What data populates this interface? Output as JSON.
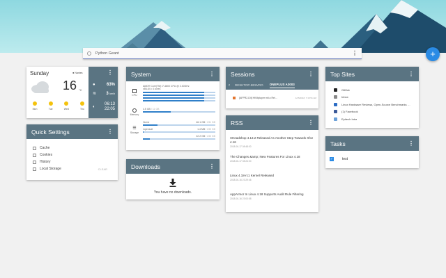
{
  "search": {
    "value": "Python Geant"
  },
  "fab": {
    "label": "+"
  },
  "weather": {
    "day": "Sunday",
    "location": "Nantes",
    "temp": "16",
    "unit": "°C",
    "humidity": "63%",
    "wind": "3",
    "wind_unit": "km/h",
    "sunrise": "06:13",
    "sunset": "22:05",
    "forecast": [
      {
        "day": "Mon"
      },
      {
        "day": "Tue"
      },
      {
        "day": "Wed"
      },
      {
        "day": "Thu"
      }
    ]
  },
  "system": {
    "title": "System",
    "cpu_label": "CPU",
    "cpu_info_1": "AMD® Core(TM) i7-4800 CPU @ 2.30GHz",
    "cpu_info_2": "x86-64 • 4 cores",
    "cpu_bars": [
      0.85,
      0.85,
      0.85,
      0.85
    ],
    "memory_label": "Memory",
    "memory_text": "4.5 GB",
    "memory_total": "/ 11 GB",
    "memory_fill": 0.38,
    "storage_label": "Storage",
    "storage": [
      {
        "name": "Home",
        "used": "46.1 GB",
        "total": "/ 231 GB",
        "fill": 0.2
      },
      {
        "name": "/opensuit",
        "used": "1.4 MB",
        "total": "/ 233 GB",
        "fill": 0.01
      },
      {
        "name": "",
        "used": "22.2 GB",
        "total": "/ 233 GB",
        "fill": 0.1
      }
    ]
  },
  "sessions": {
    "title": "Sessions",
    "tabs": [
      "DESKTOP-8E9VRO",
      "ONEPLUS A3003"
    ],
    "active_tab": 1,
    "item_text": "[AFPR2-Dit] HKMplayer mit a Rel…",
    "item_date": "4/15/2018, 7:15:51 AM"
  },
  "rss": {
    "title": "RSS",
    "items": [
      {
        "title": "XHeadshop 4.13.2 Released As Another Step Towards Xfce 4.16",
        "date": "2018-06-17 08:48:00"
      },
      {
        "title": "The Changes &amp; New Features For Linux 4.18",
        "date": "2018-06-17 08:24:00"
      },
      {
        "title": "Linux 4.18-rc1 Kernel Released",
        "date": "2018-06-16 23:29:46"
      },
      {
        "title": "AppArmor In Linux 4.18 Supports Audit Rule Filtering",
        "date": "2018-06-16 23:00:58"
      }
    ]
  },
  "quick_settings": {
    "title": "Quick Settings",
    "items": [
      "Cache",
      "Cookies",
      "History",
      "Local Storage"
    ],
    "clear": "CLEAR"
  },
  "downloads": {
    "title": "Downloads",
    "empty": "You have no downloads."
  },
  "top_sites": {
    "title": "Top Sites",
    "sites": [
      {
        "label": "GitHub",
        "icon": "github-icon",
        "color": "#222222"
      },
      {
        "label": "Inbox",
        "icon": "inbox-icon",
        "color": "#888888"
      },
      {
        "label": "Linux Hardware Reviews, Open-Source Benchmarks …",
        "icon": "phoronix-icon",
        "color": "#2b6cc4"
      },
      {
        "label": "(1) Facebook",
        "icon": "facebook-icon",
        "color": "#3b5998"
      },
      {
        "label": "Epitech Intra",
        "icon": "epitech-icon",
        "color": "#6aa0d8"
      }
    ]
  },
  "tasks": {
    "title": "Tasks",
    "items": [
      {
        "label": "test",
        "checked": true
      }
    ]
  },
  "colors": {
    "header": "#5a7482",
    "accent": "#2a8be5",
    "sun": "#f4c20d"
  }
}
